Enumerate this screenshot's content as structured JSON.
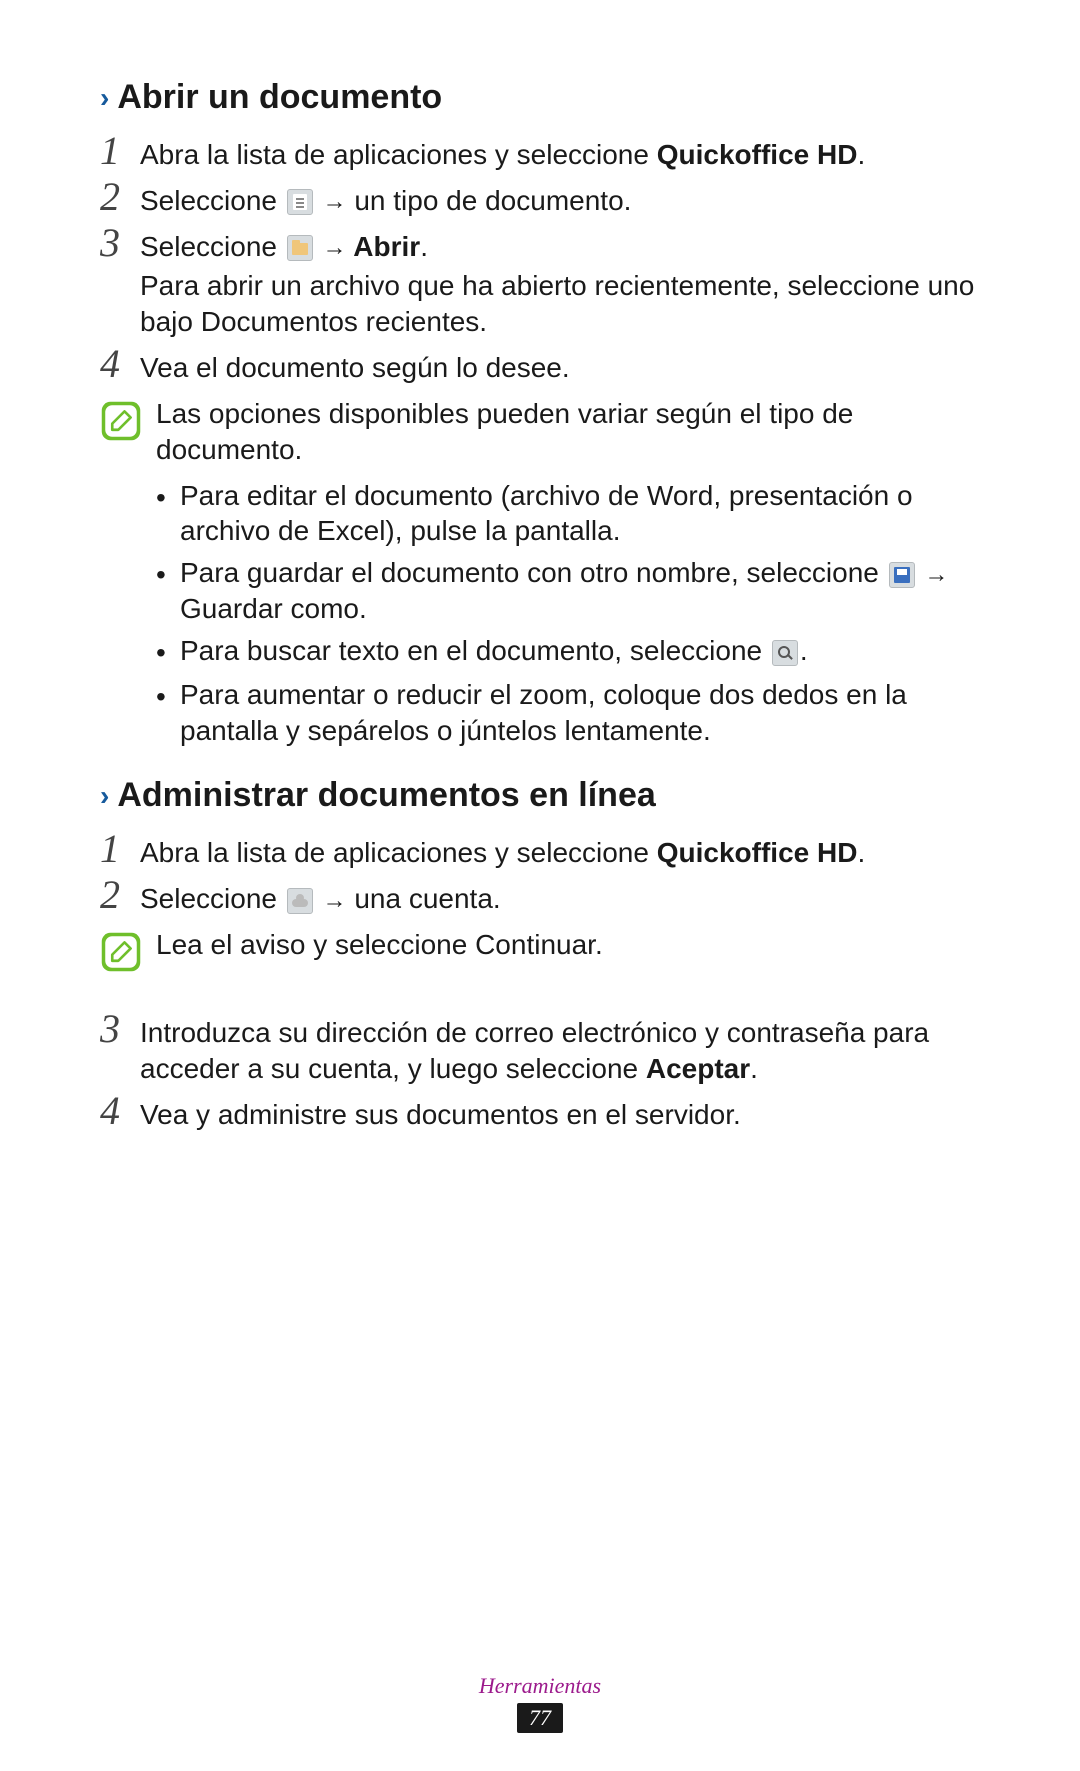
{
  "section1": {
    "title": "Abrir un documento",
    "steps": {
      "s1": {
        "num": "1",
        "pre": "Abra la lista de aplicaciones y seleccione ",
        "bold": "Quickoffice HD",
        "post": "."
      },
      "s2": {
        "num": "2",
        "pre": "Seleccione ",
        "arrow": "→",
        "post": " un tipo de documento."
      },
      "s3": {
        "num": "3",
        "pre": "Seleccione ",
        "arrow": "→",
        "bold": " Abrir",
        "post": ".",
        "sub_pre": "Para abrir un archivo que ha abierto recientemente, seleccione uno bajo ",
        "sub_bold": "Documentos recientes",
        "sub_post": "."
      },
      "s4": {
        "num": "4",
        "text": "Vea el documento según lo desee."
      }
    },
    "note": "Las opciones disponibles pueden variar según el tipo de documento.",
    "bullets": {
      "b1": "Para editar el documento (archivo de Word, presentación o archivo de Excel), pulse la pantalla.",
      "b2_pre": "Para guardar el documento con otro nombre, seleccione ",
      "b2_arrow": "→",
      "b2_bold": " Guardar como",
      "b2_post": ".",
      "b3_pre": "Para buscar texto en el documento, seleccione ",
      "b3_post": ".",
      "b4": "Para aumentar o reducir el zoom, coloque dos dedos en la pantalla y sepárelos o júntelos lentamente."
    }
  },
  "section2": {
    "title": "Administrar documentos en línea",
    "steps": {
      "s1": {
        "num": "1",
        "pre": "Abra la lista de aplicaciones y seleccione ",
        "bold": "Quickoffice HD",
        "post": "."
      },
      "s2": {
        "num": "2",
        "pre": "Seleccione ",
        "arrow": "→",
        "post": " una cuenta."
      },
      "note_pre": "Lea el aviso y seleccione ",
      "note_bold": "Continuar",
      "note_post": ".",
      "s3": {
        "num": "3",
        "pre": "Introduzca su dirección de correo electrónico y contraseña para acceder a su cuenta, y luego seleccione ",
        "bold": "Aceptar",
        "post": "."
      },
      "s4": {
        "num": "4",
        "text": "Vea y administre sus documentos en el servidor."
      }
    }
  },
  "footer": {
    "label": "Herramientas",
    "page": "77"
  }
}
